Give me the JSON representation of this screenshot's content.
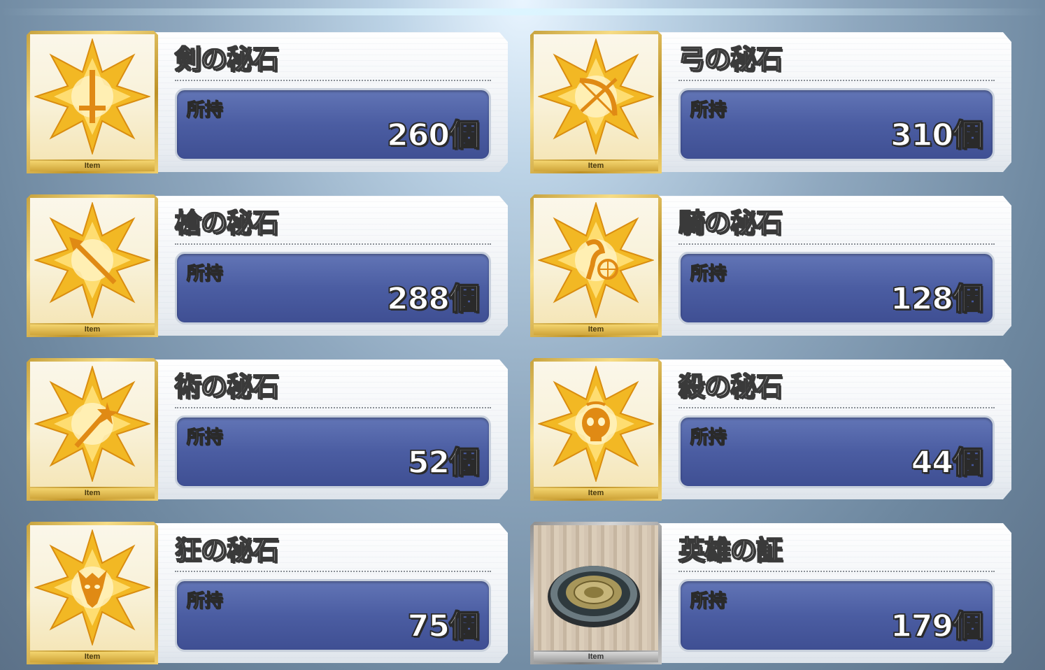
{
  "items": [
    {
      "name": "剣の秘石",
      "own_label": "所持",
      "count": "260個",
      "tag": "Item",
      "icon": "saber-gem-icon"
    },
    {
      "name": "弓の秘石",
      "own_label": "所持",
      "count": "310個",
      "tag": "Item",
      "icon": "archer-gem-icon"
    },
    {
      "name": "槍の秘石",
      "own_label": "所持",
      "count": "288個",
      "tag": "Item",
      "icon": "lancer-gem-icon"
    },
    {
      "name": "騎の秘石",
      "own_label": "所持",
      "count": "128個",
      "tag": "Item",
      "icon": "rider-gem-icon"
    },
    {
      "name": "術の秘石",
      "own_label": "所持",
      "count": "52個",
      "tag": "Item",
      "icon": "caster-gem-icon"
    },
    {
      "name": "殺の秘石",
      "own_label": "所持",
      "count": "44個",
      "tag": "Item",
      "icon": "assassin-gem-icon"
    },
    {
      "name": "狂の秘石",
      "own_label": "所持",
      "count": "75個",
      "tag": "Item",
      "icon": "berserker-gem-icon"
    },
    {
      "name": "英雄の証",
      "own_label": "所持",
      "count": "179個",
      "tag": "Item",
      "icon": "heroic-badge-icon"
    }
  ],
  "colors": {
    "gem_gold": "#f2b824",
    "count_box": "#4b5da2",
    "frame_gold": "#d9b44a"
  }
}
